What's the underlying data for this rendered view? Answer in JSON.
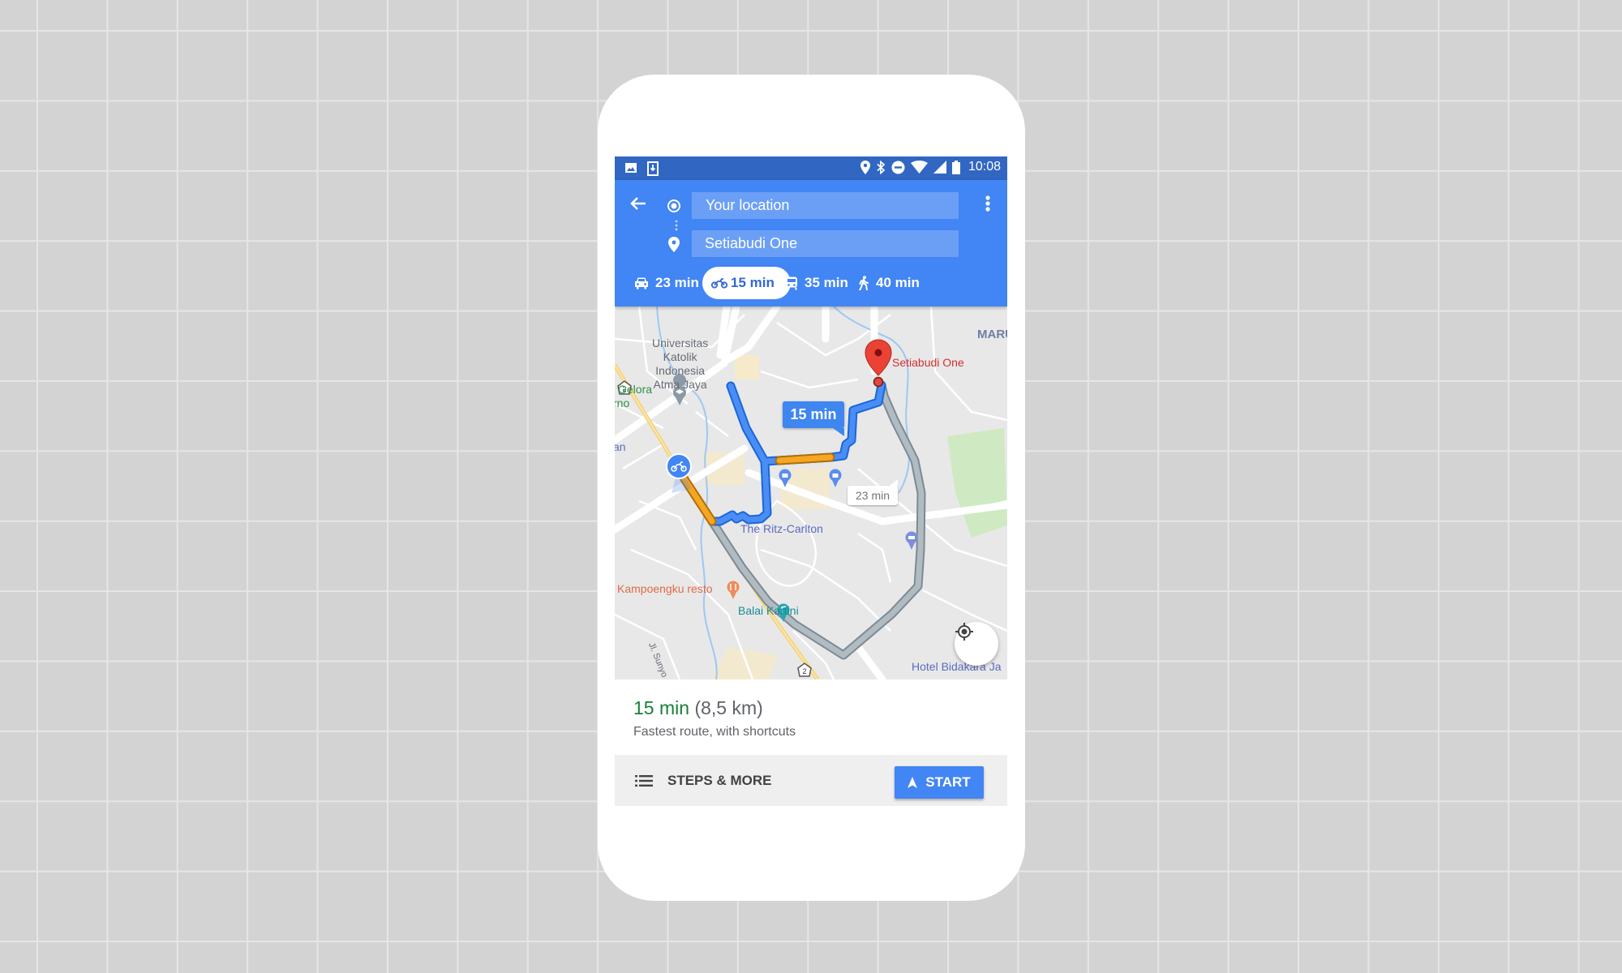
{
  "status_bar": {
    "left_icons": [
      "image-icon",
      "download-icon"
    ],
    "right_icons": [
      "location-icon",
      "bluetooth-icon",
      "do-not-disturb-icon",
      "wifi-icon",
      "signal-icon",
      "battery-icon"
    ],
    "time": "10:08"
  },
  "header": {
    "origin": {
      "value": "Your location",
      "icon": "origin-dot-icon"
    },
    "destination": {
      "value": "Setiabudi One",
      "icon": "place-pin-icon"
    },
    "modes": [
      {
        "id": "drive",
        "icon": "car-icon",
        "label": "23 min",
        "active": false
      },
      {
        "id": "motorcycle",
        "icon": "motorcycle-icon",
        "label": "15 min",
        "active": true
      },
      {
        "id": "transit",
        "icon": "train-icon",
        "label": "35 min",
        "active": false
      },
      {
        "id": "walk",
        "icon": "walk-icon",
        "label": "40 min",
        "active": false
      }
    ]
  },
  "map": {
    "destination_label": "Setiabudi One",
    "route_callouts": {
      "selected": "15 min",
      "alternative": "23 min"
    },
    "labels": {
      "university": [
        "Universitas",
        "Katolik",
        "Indonesia",
        "Atma Jaya"
      ],
      "gelora": [
        "Gelora",
        "rno"
      ],
      "left_edge": "an",
      "maru": "MARU",
      "ritz": "The Ritz-Carlton",
      "resto": "Kampoengku resto",
      "balai": "Balai Kartini",
      "street": "Jl. Sunyo",
      "hotel": "Hotel Bidakara Ja",
      "road_shield": "2"
    },
    "colors": {
      "route_selected": "#4285f4",
      "route_traffic": "#f5a623",
      "route_alternative": "#a8b1b8",
      "destination_pin": "#ea4335"
    }
  },
  "summary": {
    "duration": "15 min",
    "distance": "(8,5 km)",
    "description": "Fastest route, with shortcuts"
  },
  "actions": {
    "steps_label": "STEPS & MORE",
    "start_label": "START"
  }
}
